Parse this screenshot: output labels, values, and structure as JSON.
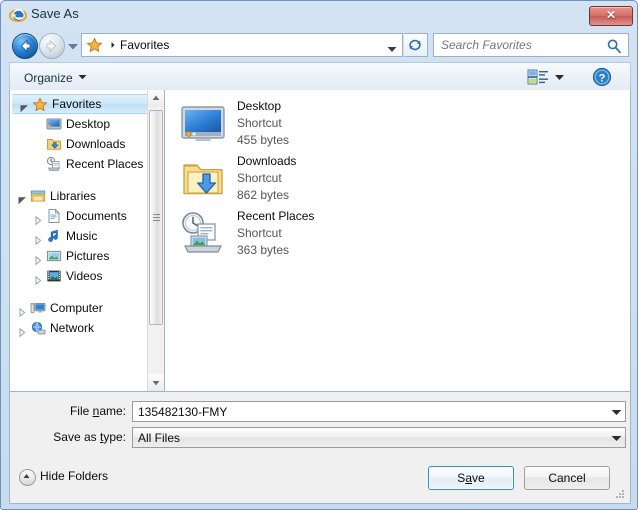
{
  "window": {
    "title": "Save As",
    "app_icon": "internet-explorer-icon",
    "close_label": "✕"
  },
  "addressbar": {
    "back_icon": "back-arrow-icon",
    "forward_icon": "forward-arrow-icon",
    "history_icon": "chevron-down-icon",
    "location_icon": "favorites-star-icon",
    "breadcrumb": "Favorites",
    "dropdown_icon": "chevron-down-icon",
    "refresh_icon": "refresh-icon",
    "search_placeholder": "Search Favorites",
    "search_value": "",
    "search_icon": "search-icon"
  },
  "toolbar": {
    "organize_label": "Organize",
    "organize_caret": "▼",
    "view_icon": "view-mode-icon",
    "view_caret": "▼",
    "help_icon": "help-icon",
    "help_label": "?"
  },
  "nav_pane": {
    "items": [
      {
        "label": "Favorites",
        "icon": "star-icon",
        "level": 0,
        "expander": "expanded",
        "selected": true
      },
      {
        "label": "Desktop",
        "icon": "desktop-icon",
        "level": 1,
        "expander": "none",
        "selected": false
      },
      {
        "label": "Downloads",
        "icon": "downloads-icon",
        "level": 1,
        "expander": "none",
        "selected": false
      },
      {
        "label": "Recent Places",
        "icon": "recent-places-icon",
        "level": 1,
        "expander": "none",
        "selected": false
      },
      {
        "label": "Libraries",
        "icon": "libraries-icon",
        "level": 0,
        "expander": "expanded",
        "selected": false
      },
      {
        "label": "Documents",
        "icon": "documents-icon",
        "level": 1,
        "expander": "collapsed",
        "selected": false
      },
      {
        "label": "Music",
        "icon": "music-icon",
        "level": 1,
        "expander": "collapsed",
        "selected": false
      },
      {
        "label": "Pictures",
        "icon": "pictures-icon",
        "level": 1,
        "expander": "collapsed",
        "selected": false
      },
      {
        "label": "Videos",
        "icon": "videos-icon",
        "level": 1,
        "expander": "collapsed",
        "selected": false
      },
      {
        "label": "Computer",
        "icon": "computer-icon",
        "level": 0,
        "expander": "collapsed",
        "selected": false
      },
      {
        "label": "Network",
        "icon": "network-icon",
        "level": 0,
        "expander": "collapsed",
        "selected": false
      }
    ],
    "scrollbar": {
      "up_icon": "scroll-up-arrow-icon",
      "down_icon": "scroll-down-arrow-icon"
    }
  },
  "file_list": {
    "items": [
      {
        "name": "Desktop",
        "type": "Shortcut",
        "size": "455 bytes",
        "icon": "desktop-shortcut-icon"
      },
      {
        "name": "Downloads",
        "type": "Shortcut",
        "size": "862 bytes",
        "icon": "downloads-shortcut-icon"
      },
      {
        "name": "Recent Places",
        "type": "Shortcut",
        "size": "363 bytes",
        "icon": "recent-places-shortcut-icon"
      }
    ]
  },
  "form": {
    "filename_label_pre": "File ",
    "filename_label_accel": "n",
    "filename_label_post": "ame:",
    "filename_value": "135482130-FMY",
    "filetype_label_pre": "Save as ",
    "filetype_label_accel": "t",
    "filetype_label_post": "ype:",
    "filetype_value": "All Files",
    "dropdown_icon": "chevron-down-icon"
  },
  "footer": {
    "hide_folders_label": "Hide Folders",
    "hide_folders_icon": "chevron-up-circle-icon",
    "save_label_pre": "S",
    "save_label_accel": "a",
    "save_label_post": "ve",
    "cancel_label": "Cancel",
    "resize_grip_icon": "resize-grip-icon"
  },
  "colors": {
    "frame": "#c8dcef",
    "accent_blue": "#2c91d8",
    "close_red": "#d6706a",
    "selection": "#cbe6f8",
    "pane_bg": "#ffffff",
    "dialog_bg": "#f0f0f0"
  }
}
